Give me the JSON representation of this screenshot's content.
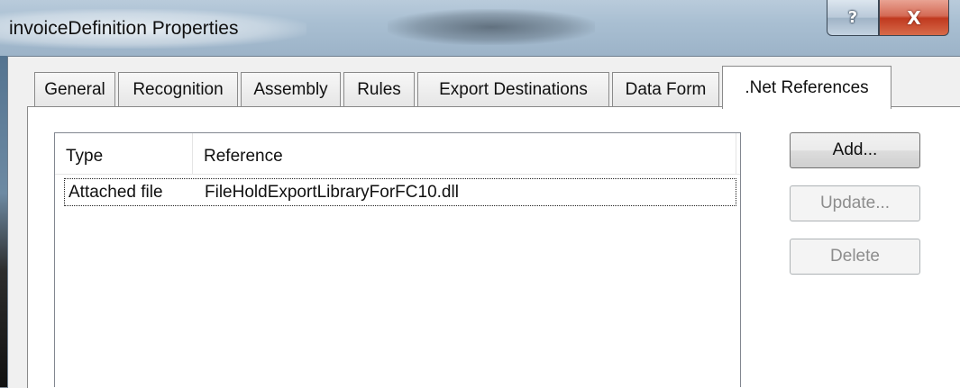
{
  "window": {
    "title": "invoiceDefinition Properties",
    "help_label": "?",
    "close_label": "X"
  },
  "tabs": [
    {
      "label": "General",
      "active": false
    },
    {
      "label": "Recognition",
      "active": false
    },
    {
      "label": "Assembly",
      "active": false
    },
    {
      "label": "Rules",
      "active": false
    },
    {
      "label": "Export Destinations",
      "active": false
    },
    {
      "label": "Data Form",
      "active": false
    },
    {
      "label": ".Net References",
      "active": true
    }
  ],
  "references": {
    "columns": [
      "Type",
      "Reference"
    ],
    "rows": [
      {
        "type": "Attached file",
        "reference": "FileHoldExportLibraryForFC10.dll"
      }
    ]
  },
  "buttons": {
    "add": {
      "label": "Add...",
      "enabled": true
    },
    "update": {
      "label": "Update...",
      "enabled": false
    },
    "delete": {
      "label": "Delete",
      "enabled": false
    }
  }
}
